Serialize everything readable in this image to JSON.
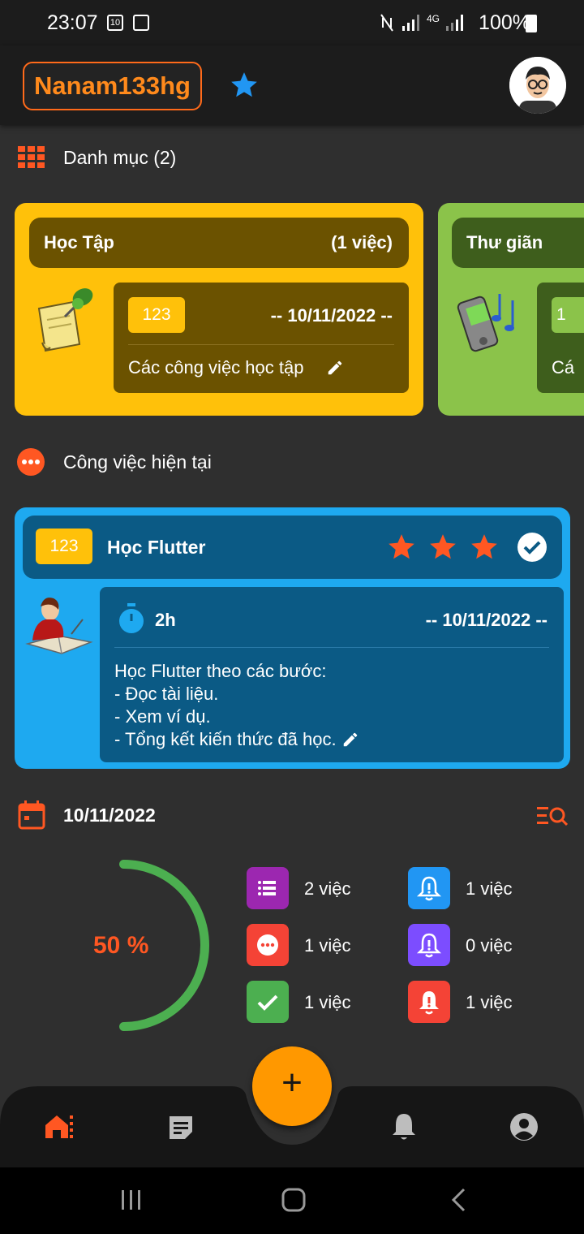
{
  "status_bar": {
    "time": "23:07",
    "date_icon": "10",
    "battery": "100%",
    "network": "4G"
  },
  "header": {
    "username": "Nanam133hg",
    "star_icon": "star-icon",
    "avatar": "avatar"
  },
  "categories": {
    "title": "Danh mục (2)",
    "items": [
      {
        "name": "Học Tập",
        "count": "(1 việc)",
        "badge": "123",
        "date": "-- 10/11/2022 --",
        "description": "Các công việc học tập",
        "color": "#ffc10a"
      },
      {
        "name": "Thư giãn",
        "badge": "1",
        "description": "Cá",
        "color": "#8bc34a"
      }
    ]
  },
  "current_task": {
    "title": "Công việc hiện tại",
    "badge": "123",
    "name": "Học Flutter",
    "duration": "2h",
    "date": "-- 10/11/2022 --",
    "description": [
      "Học Flutter theo các bước:",
      "- Đọc tài liệu.",
      "- Xem ví dụ.",
      "- Tổng kết kiến thức đã học."
    ]
  },
  "summary": {
    "date": "10/11/2022",
    "progress": 50,
    "progress_label": "50 %",
    "stats": [
      {
        "icon": "list-icon",
        "label": "2 việc",
        "color": "#9c27b0"
      },
      {
        "icon": "more-icon",
        "label": "1 việc",
        "color": "#f44336"
      },
      {
        "icon": "check-icon",
        "label": "1 việc",
        "color": "#4caf50"
      },
      {
        "icon": "bell-icon",
        "label": "1 việc",
        "color": "#2196f3"
      },
      {
        "icon": "bell-icon",
        "label": "0 việc",
        "color": "#7c4dff"
      },
      {
        "icon": "bell-icon",
        "label": "1 việc",
        "color": "#f44336"
      }
    ]
  },
  "bottom_nav": {
    "items": [
      "home-icon",
      "notes-icon",
      "bell-icon",
      "account-icon"
    ],
    "fab": "+"
  },
  "colors": {
    "accent": "#ff5722",
    "fab": "#ff9800",
    "task_card": "#1ea9f0"
  }
}
